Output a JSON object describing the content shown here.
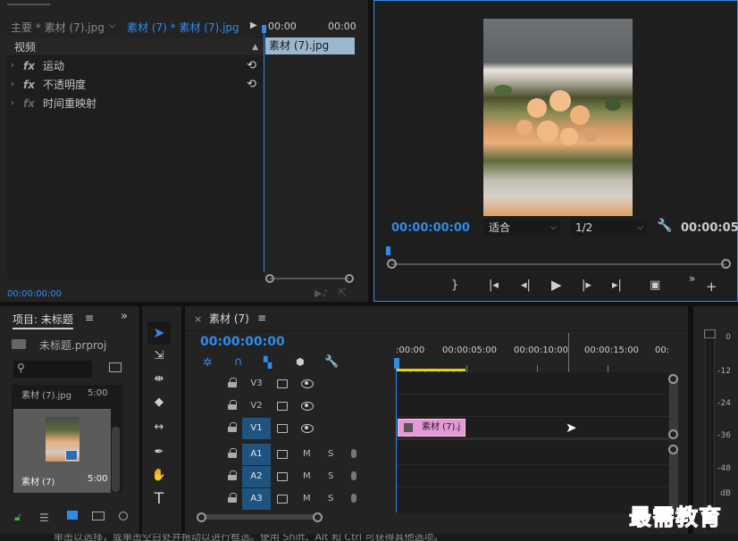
{
  "effect_controls": {
    "source_tab": "主要 * 素材 (7).jpg",
    "seq_tab": "素材 (7) * 素材 (7).jpg",
    "ruler_start": "00:00",
    "ruler_end": "00:00",
    "clip_label": "素材 (7).jpg",
    "section": "视频",
    "effects": [
      {
        "label": "运动"
      },
      {
        "label": "不透明度"
      },
      {
        "label": "时间重映射"
      }
    ],
    "timecode": "00:00:00:00"
  },
  "program": {
    "timecode": "00:00:00:00",
    "fit": "适合",
    "resolution": "1/2",
    "duration": "00:00:05"
  },
  "project": {
    "title": "项目: 未标题",
    "file": "未标题.prproj",
    "item1_name": "素材 (7).jpg",
    "item1_dur": "5:00",
    "item2_name": "素材 (7)",
    "item2_dur": "5:00"
  },
  "timeline": {
    "title": "素材 (7)",
    "timecode": "00:00:00:00",
    "ruler": [
      ":00:00",
      "00:00:05:00",
      "00:00:10:00",
      "00:00:15:00",
      "00:"
    ],
    "tracks": [
      {
        "name": "V3",
        "type": "video",
        "on": false
      },
      {
        "name": "V2",
        "type": "video",
        "on": false
      },
      {
        "name": "V1",
        "type": "video",
        "on": true
      },
      {
        "name": "A1",
        "type": "audio",
        "on": true
      },
      {
        "name": "A2",
        "type": "audio",
        "on": true
      },
      {
        "name": "A3",
        "type": "audio",
        "on": true
      }
    ],
    "clip_label": "素材 (7).j",
    "mute": "M",
    "solo": "S"
  },
  "meter_scale": [
    "0",
    "-12",
    "-24",
    "-36",
    "-48",
    "dB"
  ],
  "watermark": "最需教育",
  "status_bar": "单击以选择，或单击空白处并拖动以进行框选。使用 Shift、Alt 和 Ctrl 可获得其他选项。",
  "colors": {
    "accent": "#2d8ceb",
    "clip": "#e597d6",
    "track_on": "#1f5480",
    "workarea": "#e6d300"
  }
}
